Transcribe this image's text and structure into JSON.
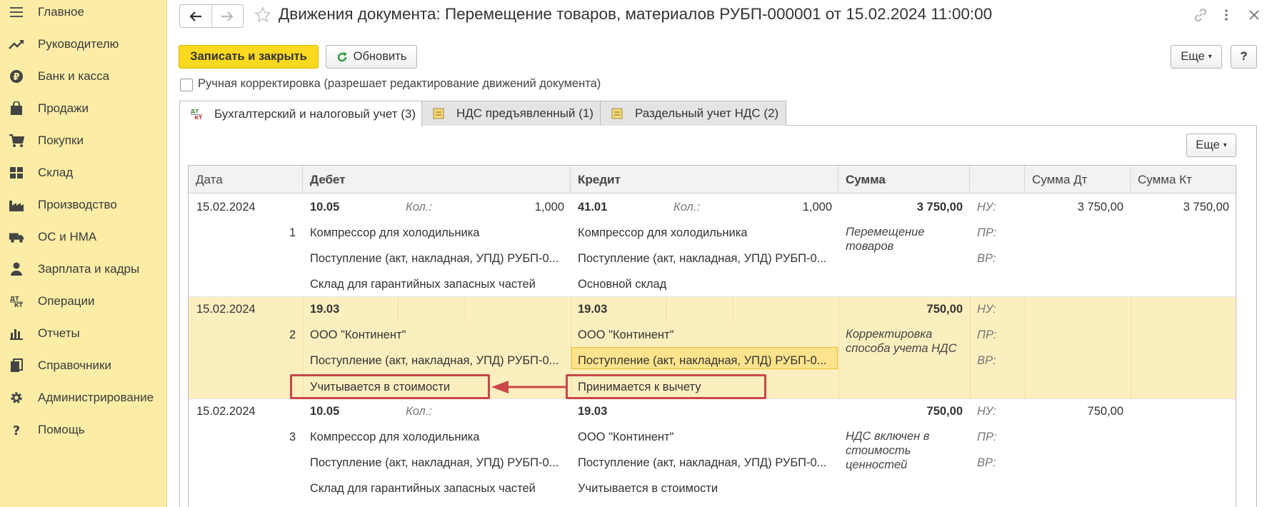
{
  "window": {
    "title": "Движения документа: Перемещение товаров, материалов РУБП-000001 от 15.02.2024 11:00:00"
  },
  "sidebar": {
    "items": [
      {
        "label": "Главное",
        "icon": "menu-lines-icon"
      },
      {
        "label": "Руководителю",
        "icon": "trend-up-icon"
      },
      {
        "label": "Банк и касса",
        "icon": "coin-icon"
      },
      {
        "label": "Продажи",
        "icon": "shopping-bag-icon"
      },
      {
        "label": "Покупки",
        "icon": "cart-icon"
      },
      {
        "label": "Склад",
        "icon": "warehouse-icon"
      },
      {
        "label": "Производство",
        "icon": "factory-icon"
      },
      {
        "label": "ОС и НМА",
        "icon": "truck-icon"
      },
      {
        "label": "Зарплата и кадры",
        "icon": "person-icon"
      },
      {
        "label": "Операции",
        "icon": "dt-kt-icon"
      },
      {
        "label": "Отчеты",
        "icon": "bar-chart-icon"
      },
      {
        "label": "Справочники",
        "icon": "books-icon"
      },
      {
        "label": "Администрирование",
        "icon": "gear-icon"
      },
      {
        "label": "Помощь",
        "icon": "question-icon"
      }
    ]
  },
  "toolbar": {
    "save_close": "Записать и закрыть",
    "refresh": "Обновить",
    "more": "Еще",
    "help": "?"
  },
  "manual_edit_label": "Ручная корректировка (разрешает редактирование движений документа)",
  "tabs": [
    {
      "label": "Бухгалтерский и налоговый учет (3)",
      "active": true
    },
    {
      "label": "НДС предъявленный (1)",
      "active": false
    },
    {
      "label": "Раздельный учет НДС (2)",
      "active": false
    }
  ],
  "grid": {
    "more": "Еще",
    "dt_kt_icon_text": {
      "dt": "ДТ",
      "kt": "КТ"
    },
    "columns": [
      "Дата",
      "Дебет",
      "Кредит",
      "Сумма",
      "",
      "Сумма Дт",
      "Сумма Кт"
    ],
    "labels": {
      "qty": "Кол.:",
      "nu": "НУ:",
      "pr": "ПР:",
      "vr": "ВР:"
    },
    "rows": [
      {
        "date": "15.02.2024",
        "num": "1",
        "debit_account": "10.05",
        "debit_qty": "1,000",
        "debit_lines": [
          "Компрессор для холодильника",
          "Поступление (акт, накладная, УПД) РУБП-0...",
          "Склад для гарантийных запасных частей"
        ],
        "credit_account": "41.01",
        "credit_qty": "1,000",
        "credit_lines": [
          "Компрессор для холодильника",
          "Поступление (акт, накладная, УПД) РУБП-0...",
          "Основной склад"
        ],
        "sum": "3 750,00",
        "content": "Перемещение товаров",
        "sum_dt": "3 750,00",
        "sum_kt": "3 750,00"
      },
      {
        "date": "15.02.2024",
        "num": "2",
        "debit_account": "19.03",
        "debit_lines": [
          "ООО \"Континент\"",
          "Поступление (акт, накладная, УПД) РУБП-0...",
          "Учитывается в стоимости"
        ],
        "credit_account": "19.03",
        "credit_lines": [
          "ООО \"Континент\"",
          "Поступление (акт, накладная, УПД) РУБП-0...",
          "Принимается к вычету"
        ],
        "sum": "750,00",
        "content": "Корректировка способа учета НДС"
      },
      {
        "date": "15.02.2024",
        "num": "3",
        "debit_account": "10.05",
        "debit_lines": [
          "Компрессор для холодильника",
          "Поступление (акт, накладная, УПД) РУБП-0...",
          "Склад для гарантийных запасных частей"
        ],
        "credit_account": "19.03",
        "credit_lines": [
          "ООО \"Континент\"",
          "Поступление (акт, накладная, УПД) РУБП-0...",
          "Учитывается в стоимости"
        ],
        "sum": "750,00",
        "content": "НДС включен в стоимость ценностей",
        "sum_dt": "750,00"
      }
    ]
  },
  "colors": {
    "sidebar_bg": "#fbeda6",
    "primary_button": "#fbd91e",
    "selected_row": "#fcefbf",
    "annotation_red": "#c8474a"
  }
}
